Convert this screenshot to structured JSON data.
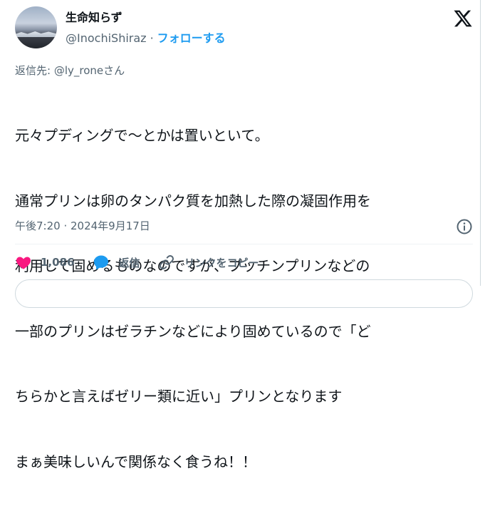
{
  "author": {
    "name": "生命知らず",
    "handle": "@InochiShiraz",
    "separator": "·",
    "follow_label": "フォローする"
  },
  "reply_to": "返信先: @ly_roneさん",
  "tweet": {
    "lines": [
      "元々プディングで～とかは置いといて。",
      "通常プリンは卵のタンパク質を加熱した際の凝固作用を",
      "利用して固めるものなのですが、プッチンプリンなどの",
      "一部のプリンはゼラチンなどにより固めているので「ど",
      "ちらかと言えばゼリー類に近い」プリンとなります",
      "まぁ美味しいんで関係なく食うね！！"
    ]
  },
  "timestamp": "午後7:20 · 2024年9月17日",
  "actions": {
    "like_count": "1,086",
    "reply_label": "返信",
    "copy_link_label": "リンクをコピー"
  },
  "icons": {
    "logo": "x-logo-icon",
    "info": "info-icon",
    "like": "heart-icon",
    "reply": "speech-bubble-icon",
    "link": "link-icon"
  },
  "colors": {
    "accent": "#1d9bf0",
    "like": "#f91880",
    "text": "#0f1419",
    "muted": "#536471"
  }
}
